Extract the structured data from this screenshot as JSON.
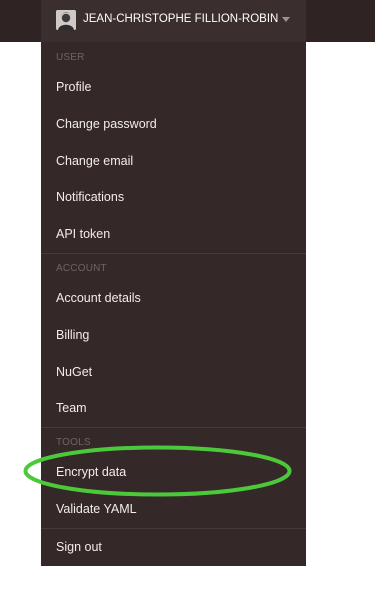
{
  "user": {
    "name": "JEAN-CHRISTOPHE FILLION-ROBIN",
    "avatar_icon": "user-avatar"
  },
  "menu": {
    "sections": [
      {
        "label": "USER",
        "items": [
          "Profile",
          "Change password",
          "Change email",
          "Notifications",
          "API token"
        ]
      },
      {
        "label": "ACCOUNT",
        "items": [
          "Account details",
          "Billing",
          "NuGet",
          "Team"
        ]
      },
      {
        "label": "TOOLS",
        "items": [
          "Encrypt data",
          "Validate YAML"
        ]
      }
    ],
    "sign_out": "Sign out"
  },
  "colors": {
    "topbar": "#2f2423",
    "dropdown_bg": "#342928",
    "highlight_ring": "#4cc93a"
  }
}
